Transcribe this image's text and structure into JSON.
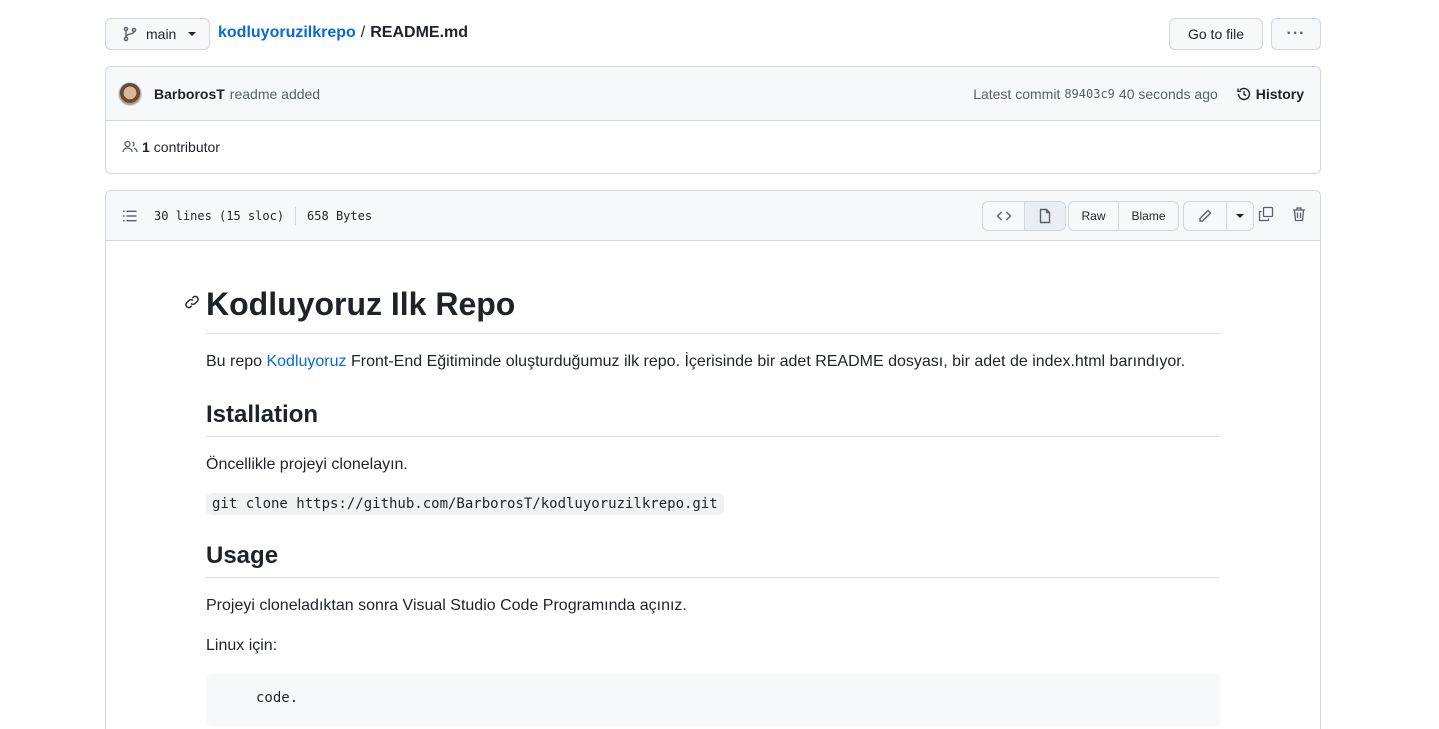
{
  "branch": {
    "label": "main"
  },
  "breadcrumb": {
    "repo": "kodluyoruzilkrepo",
    "separator": "/",
    "file": "README.md"
  },
  "toolbar": {
    "goto_label": "Go to file",
    "more_label": "···"
  },
  "commit": {
    "author": "BarborosT",
    "message": "readme added",
    "latest_label": "Latest commit",
    "sha": "89403c9",
    "time": "40 seconds ago",
    "history_label": "History"
  },
  "contributors": {
    "count": "1",
    "label": "contributor"
  },
  "file_header": {
    "lines": "30 lines (15 sloc)",
    "size": "658 Bytes",
    "raw_label": "Raw",
    "blame_label": "Blame"
  },
  "readme": {
    "title": "Kodluyoruz Ilk Repo",
    "intro_pre": "Bu repo ",
    "intro_link": "Kodluyoruz",
    "intro_post": " Front-End Eğitiminde oluşturduğumuz ilk repo. İçerisinde bir adet README dosyası, bir adet de index.html barındıyor.",
    "h_install": "Istallation",
    "install_text": "Öncellikle projeyi clonelayın.",
    "clone_cmd": "git clone https://github.com/BarborosT/kodluyoruzilkrepo.git",
    "h_usage": "Usage",
    "usage_text": "Projeyi cloneladıktan sonra Visual Studio Code Programında açınız.",
    "linux_label": "Linux için:",
    "code_cmd": "code."
  }
}
